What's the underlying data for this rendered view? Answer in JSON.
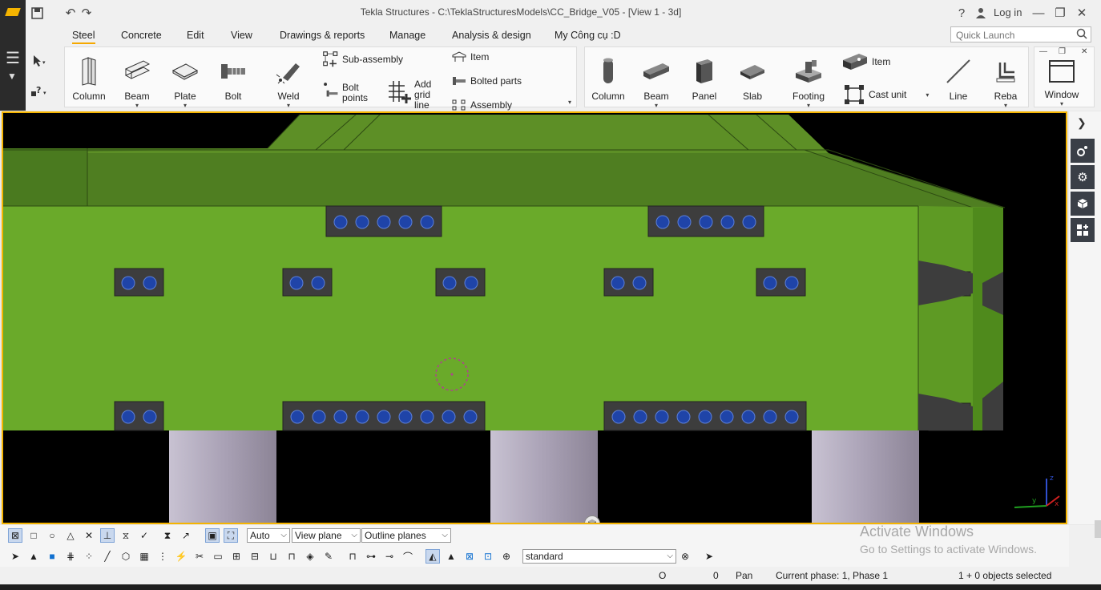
{
  "app": {
    "title": "Tekla Structures - C:\\TeklaStructuresModels\\CC_Bridge_V05 - [View 1 - 3d]",
    "login_label": "Log in",
    "help_label": "?"
  },
  "ribbon": {
    "tabs": [
      {
        "label": "Steel",
        "active": true
      },
      {
        "label": "Concrete"
      },
      {
        "label": "Edit"
      },
      {
        "label": "View"
      },
      {
        "label": "Drawings & reports"
      },
      {
        "label": "Manage"
      },
      {
        "label": "Analysis & design"
      },
      {
        "label": "My Công cụ :D"
      }
    ],
    "quick_launch_placeholder": "Quick Launch",
    "steel": {
      "column": "Column",
      "beam": "Beam",
      "plate": "Plate",
      "bolt": "Bolt",
      "weld": "Weld",
      "sub_assembly": "Sub-assembly",
      "bolt_points_1": "Bolt",
      "bolt_points_2": "points",
      "add_grid_1": "Add",
      "add_grid_2": "grid",
      "add_grid_3": "line",
      "item": "Item",
      "bolted_parts": "Bolted parts",
      "assembly": "Assembly"
    },
    "concrete": {
      "column": "Column",
      "beam": "Beam",
      "panel": "Panel",
      "slab": "Slab",
      "footing": "Footing",
      "item": "Item",
      "cast_unit": "Cast unit",
      "line": "Line",
      "rebar": "Reba"
    },
    "window_label": "Window"
  },
  "toolbar1": {
    "dropdowns": [
      {
        "name": "snap-depth",
        "value": "Auto"
      },
      {
        "name": "snap-plane",
        "value": "View plane"
      },
      {
        "name": "plane-type",
        "value": "Outline planes"
      }
    ]
  },
  "toolbar2": {
    "selection_filter": "standard"
  },
  "watermark": {
    "line1": "Activate Windows",
    "line2": "Go to Settings to activate Windows."
  },
  "status": {
    "o_label": "O",
    "zero": "0",
    "mode": "Pan",
    "phase": "Current phase: 1, Phase 1",
    "selection": "1 + 0 objects selected"
  },
  "colors": {
    "accent": "#f5b400",
    "green_face": "#6aaa2a",
    "green_top": "#4f7e21",
    "plate": "#3d3d3d",
    "bolt": "#1f44a8",
    "pier": "#aaa2b6"
  }
}
